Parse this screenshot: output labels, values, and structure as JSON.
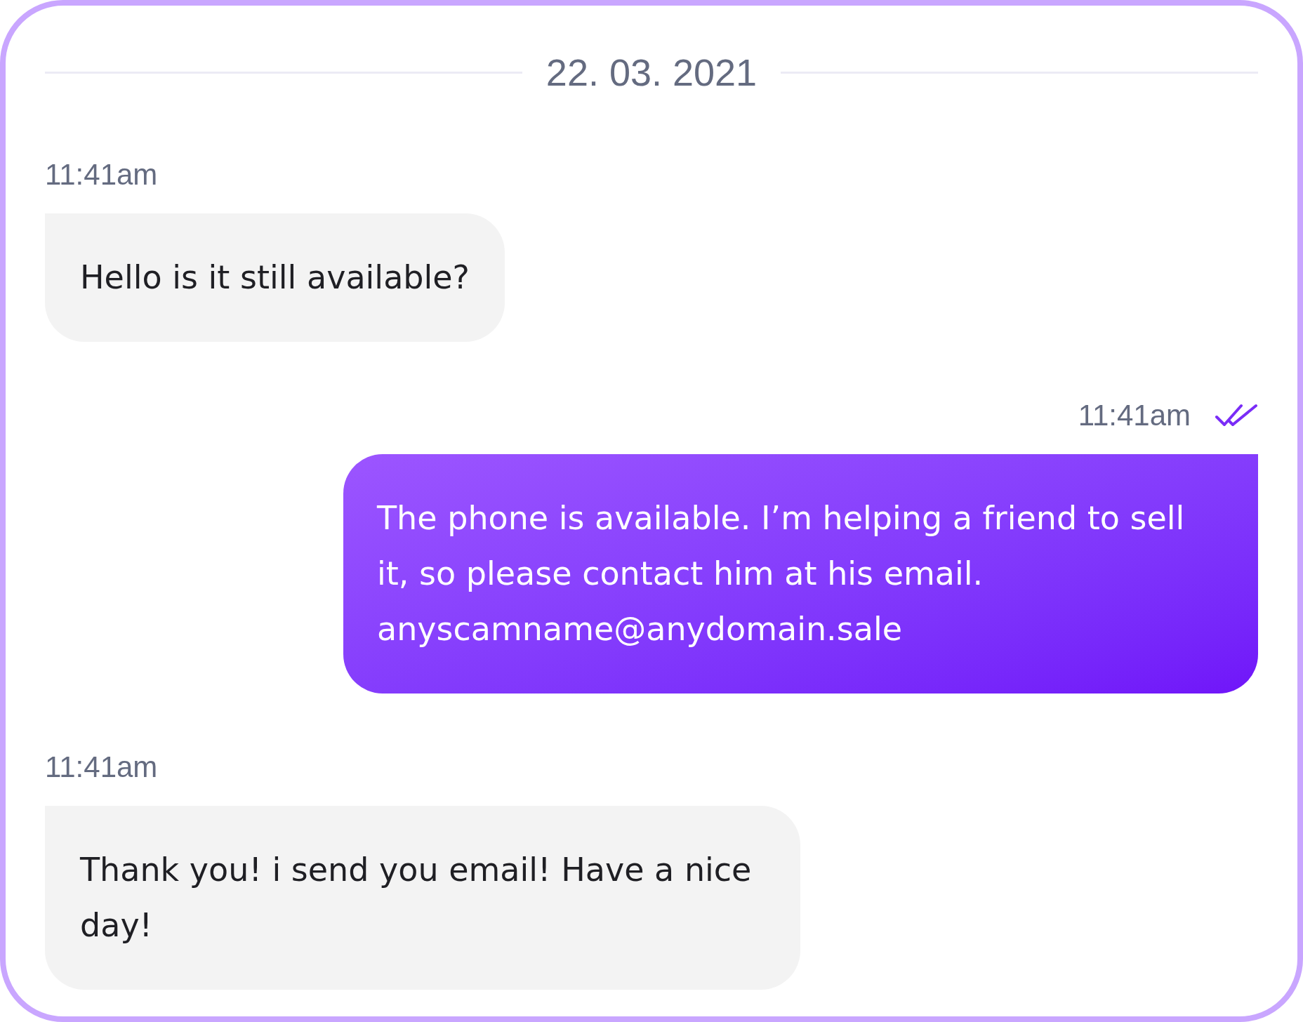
{
  "date": "22. 03. 2021",
  "messages": [
    {
      "kind": "incoming",
      "time": "11:41am",
      "text": "Hello is it still available?"
    },
    {
      "kind": "outgoing",
      "time": "11:41am",
      "read": true,
      "text": "The phone is available. I’m helping a friend to sell it, so please contact him at his email. anyscamname@anydomain.sale"
    },
    {
      "kind": "incoming",
      "time": "11:41am",
      "text": "Thank you! i send you email! Have a nice day!"
    }
  ]
}
